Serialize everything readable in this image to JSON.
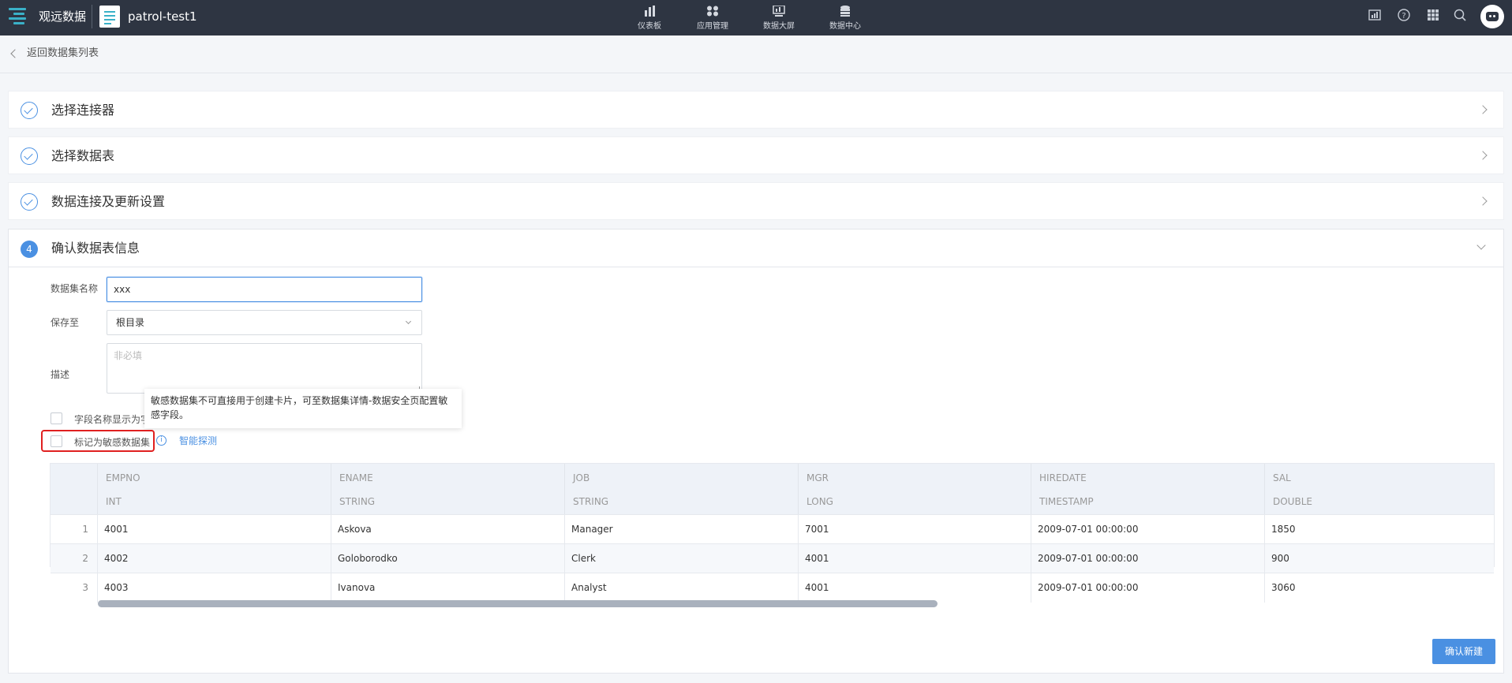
{
  "topbar": {
    "app_name": "观远数据",
    "project_name": "patrol-test1",
    "nav": [
      {
        "label": "仪表板",
        "icon": "bar-chart-icon"
      },
      {
        "label": "应用管理",
        "icon": "apps-icon"
      },
      {
        "label": "数据大屏",
        "icon": "screen-icon"
      },
      {
        "label": "数据中心",
        "icon": "database-icon"
      }
    ],
    "tools": [
      "chart-icon",
      "help-icon",
      "grid-icon",
      "search-icon"
    ]
  },
  "back": {
    "label": "返回数据集列表"
  },
  "steps": [
    {
      "label": "选择连接器"
    },
    {
      "label": "选择数据表"
    },
    {
      "label": "数据连接及更新设置"
    }
  ],
  "step4": {
    "number": "4",
    "label": "确认数据表信息",
    "form": {
      "name_label": "数据集名称",
      "name_value": "xxx",
      "save_label": "保存至",
      "save_value": "根目录",
      "desc_label": "描述",
      "desc_placeholder": "非必填",
      "field_display_label": "字段名称显示为字",
      "sensitive_label": "标记为敏感数据集",
      "smart_detect": "智能探测",
      "tooltip": "敏感数据集不可直接用于创建卡片，可至数据集详情-数据安全页配置敏感字段。"
    },
    "table": {
      "columns": [
        {
          "name": "EMPNO",
          "type": "INT"
        },
        {
          "name": "ENAME",
          "type": "STRING"
        },
        {
          "name": "JOB",
          "type": "STRING"
        },
        {
          "name": "MGR",
          "type": "LONG"
        },
        {
          "name": "HIREDATE",
          "type": "TIMESTAMP"
        },
        {
          "name": "SAL",
          "type": "DOUBLE"
        }
      ],
      "rows": [
        {
          "num": "1",
          "cells": [
            "4001",
            "Askova",
            "Manager",
            "7001",
            "2009-07-01 00:00:00",
            "1850"
          ]
        },
        {
          "num": "2",
          "cells": [
            "4002",
            "Goloborodko",
            "Clerk",
            "4001",
            "2009-07-01 00:00:00",
            "900"
          ]
        },
        {
          "num": "3",
          "cells": [
            "4003",
            "Ivanova",
            "Analyst",
            "4001",
            "2009-07-01 00:00:00",
            "3060"
          ]
        }
      ]
    },
    "confirm_label": "确认新建"
  },
  "colors": {
    "accent": "#4a90e2",
    "topbar": "#2e3542",
    "highlight": "#e02020"
  }
}
